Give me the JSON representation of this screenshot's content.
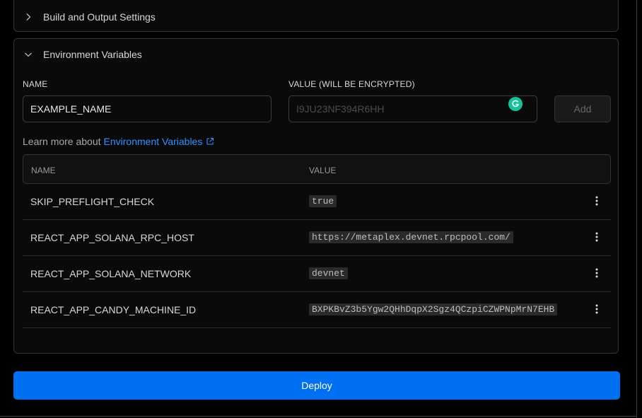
{
  "build_section": {
    "title": "Build and Output Settings",
    "expanded": false
  },
  "env_section": {
    "title": "Environment Variables",
    "expanded": true,
    "name_label": "NAME",
    "name_value": "EXAMPLE_NAME",
    "value_label": "VALUE (WILL BE ENCRYPTED)",
    "value_placeholder": "I9JU23NF394R6HH",
    "add_label": "Add",
    "learn_prefix": "Learn more about",
    "learn_link": "Environment Variables",
    "table": {
      "col_name": "NAME",
      "col_value": "VALUE",
      "rows": [
        {
          "name": "SKIP_PREFLIGHT_CHECK",
          "value": "true"
        },
        {
          "name": "REACT_APP_SOLANA_RPC_HOST",
          "value": "https://metaplex.devnet.rpcpool.com/"
        },
        {
          "name": "REACT_APP_SOLANA_NETWORK",
          "value": "devnet"
        },
        {
          "name": "REACT_APP_CANDY_MACHINE_ID",
          "value": "BXPKBvZ3b5Ygw2QHhDqpX2Sgz4QCzpiCZWPNpMrN7EHB"
        }
      ]
    }
  },
  "deploy_label": "Deploy",
  "colors": {
    "accent": "#0070f3",
    "link": "#3291ff",
    "grammarly": "#15c39a"
  }
}
